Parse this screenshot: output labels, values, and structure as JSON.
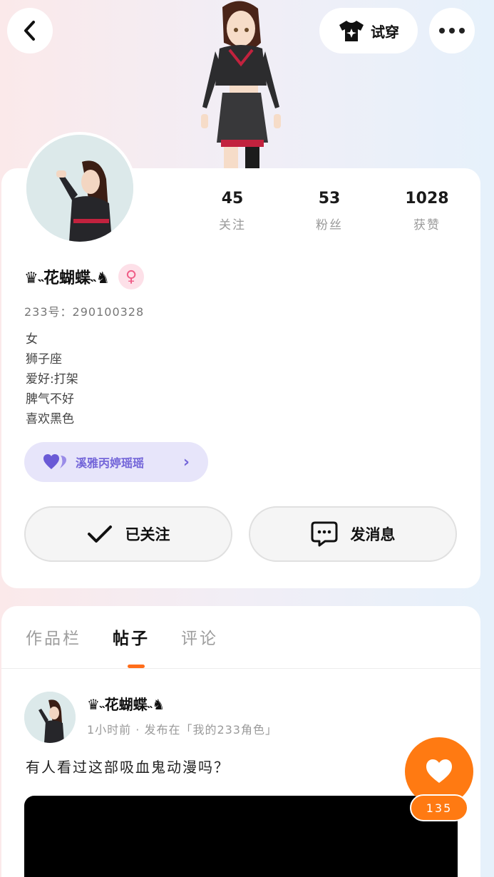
{
  "header": {
    "try_on_label": "试穿"
  },
  "profile": {
    "nickname": "♛˵花蝴蝶˵♞",
    "gender_symbol": "♀",
    "user_id": "233号：290100328",
    "stats": [
      {
        "value": "45",
        "label": "关注"
      },
      {
        "value": "53",
        "label": "粉丝"
      },
      {
        "value": "1028",
        "label": "获赞"
      }
    ],
    "bio_lines": [
      "女",
      "狮子座",
      "爱好:打架",
      "脾气不好",
      "喜欢黑色"
    ],
    "friend_pill_label": "溪雅丙婷瑶瑶",
    "follow_button_label": "已关注",
    "message_button_label": "发消息"
  },
  "tabs": [
    {
      "label": "作品栏",
      "active": false
    },
    {
      "label": "帖子",
      "active": true
    },
    {
      "label": "评论",
      "active": false
    }
  ],
  "post": {
    "author": "♛˵花蝴蝶˵♞",
    "meta": "1小时前 · 发布在「我的233角色」",
    "text": "有人看过这部吸血鬼动漫吗？",
    "like_count": "135"
  },
  "colors": {
    "accent_orange": "#ff7a12",
    "friend_pill_bg": "#e7e5fa",
    "friend_pill_text": "#7466d9",
    "gender_pink": "#ef5b86"
  }
}
